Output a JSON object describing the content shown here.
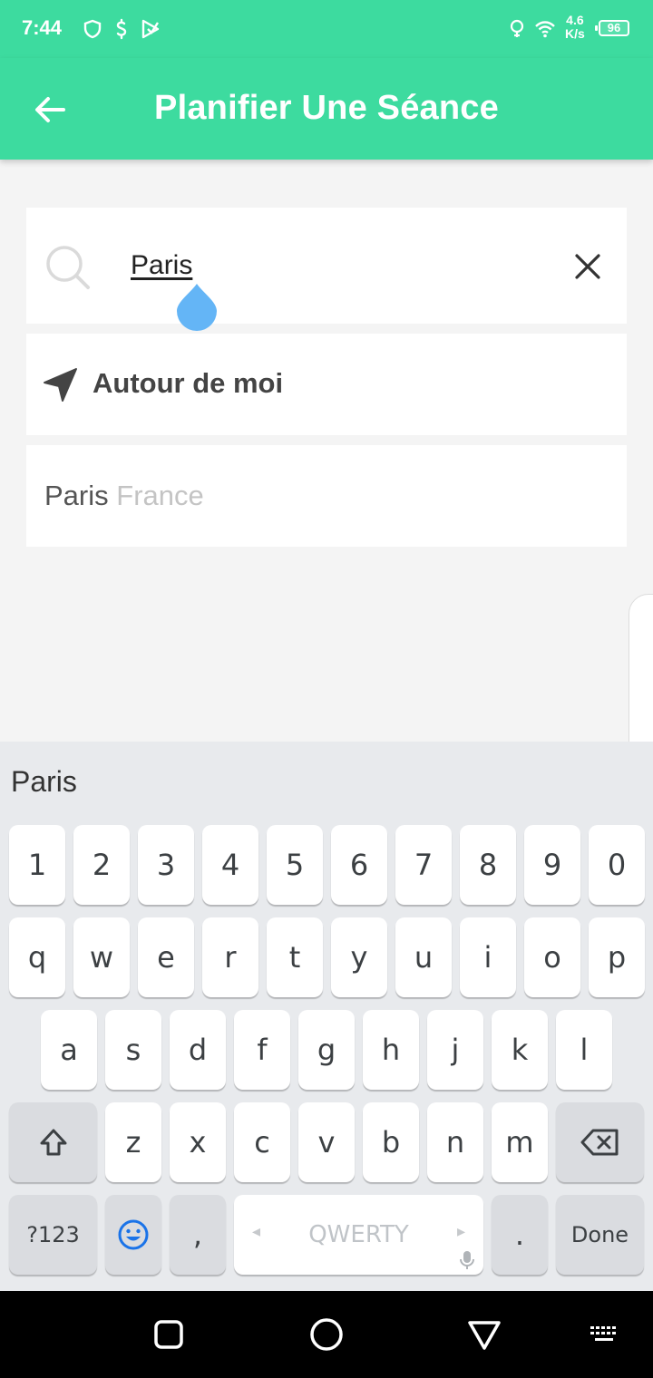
{
  "status_bar": {
    "time": "7:44",
    "speed_value": "4.6",
    "speed_unit": "K/s",
    "battery": "96"
  },
  "app_bar": {
    "title": "Planifier Une Séance",
    "back_icon": "arrow-left-icon"
  },
  "search": {
    "value": "Paris",
    "search_icon": "search-icon",
    "clear_icon": "close-icon"
  },
  "around_me": {
    "label": "Autour de moi",
    "icon": "navigation-arrow-icon"
  },
  "results": [
    {
      "city": "Paris",
      "country": "France"
    }
  ],
  "keyboard": {
    "suggestion": "Paris",
    "row1": [
      "1",
      "2",
      "3",
      "4",
      "5",
      "6",
      "7",
      "8",
      "9",
      "0"
    ],
    "row2": [
      "q",
      "w",
      "e",
      "r",
      "t",
      "y",
      "u",
      "i",
      "o",
      "p"
    ],
    "row3": [
      "a",
      "s",
      "d",
      "f",
      "g",
      "h",
      "j",
      "k",
      "l"
    ],
    "row4": [
      "z",
      "x",
      "c",
      "v",
      "b",
      "n",
      "m"
    ],
    "symbols_key": "?123",
    "comma_key": ",",
    "space_label": "QWERTY",
    "period_key": ".",
    "done_key": "Done"
  },
  "colors": {
    "accent": "#3ddb9f",
    "cursor_handle": "#64b5f6",
    "background": "#f4f4f4"
  }
}
